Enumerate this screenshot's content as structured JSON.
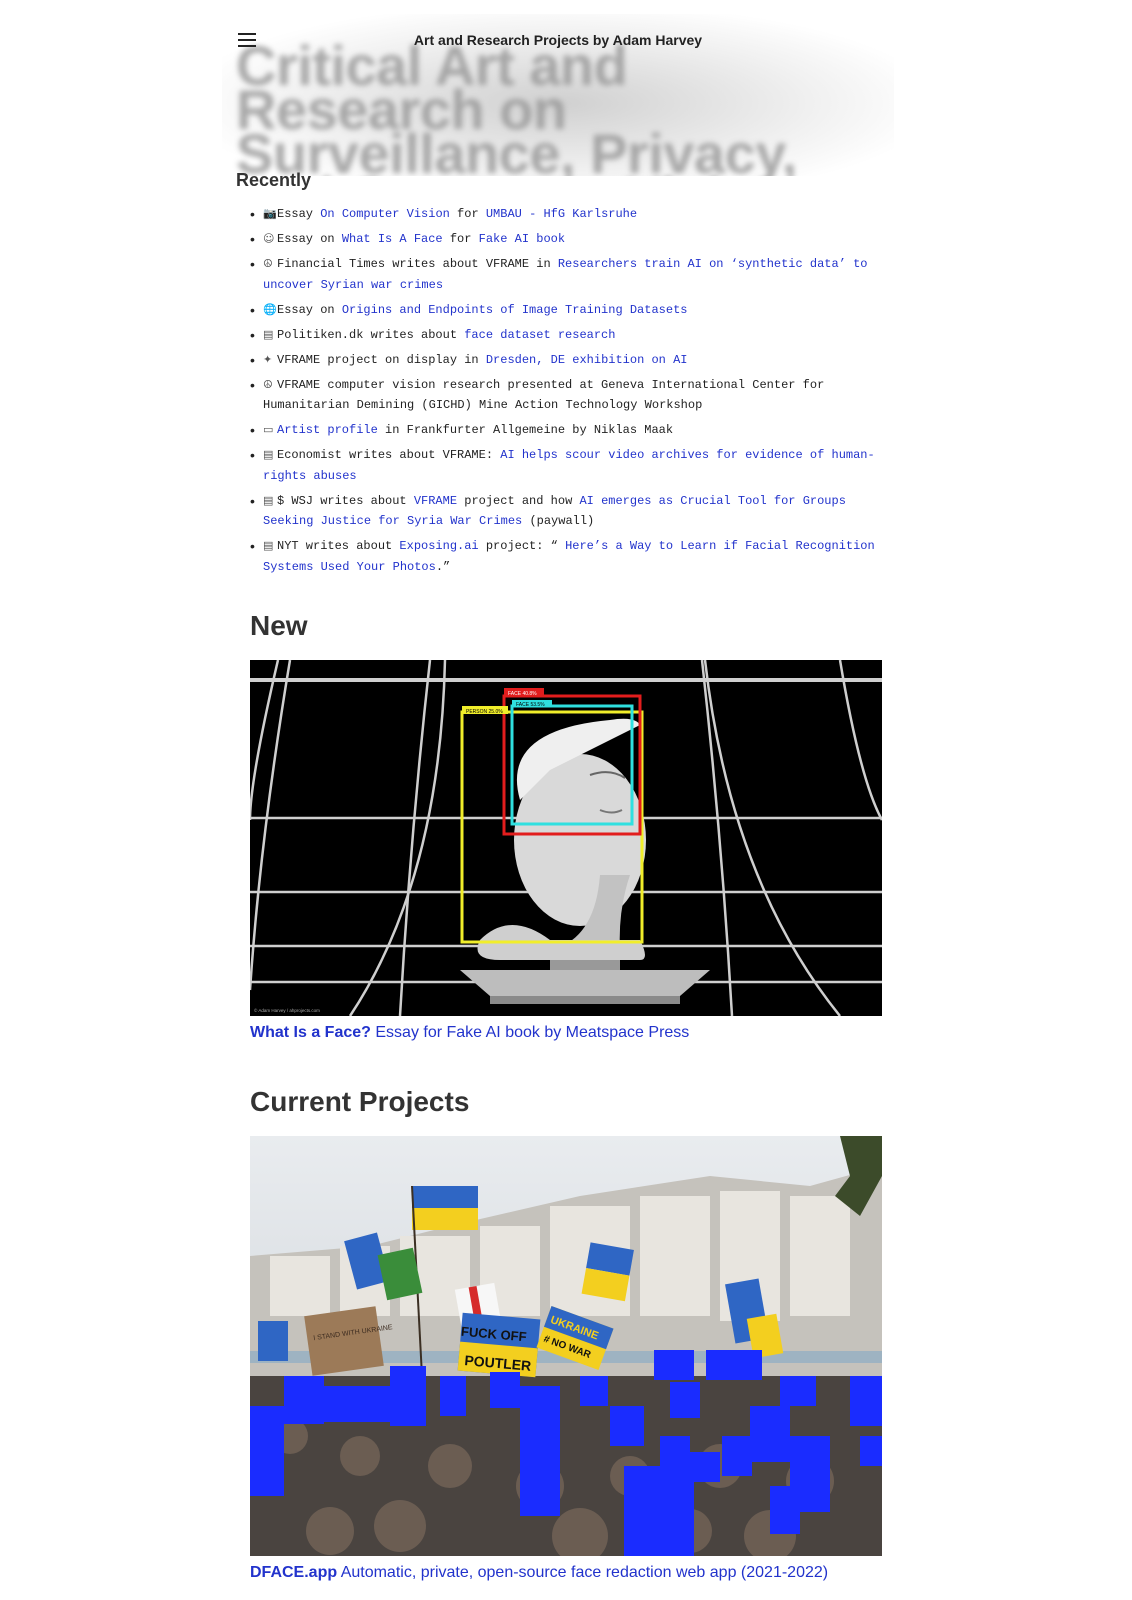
{
  "header": {
    "site_title": "Art and Research Projects by Adam Harvey",
    "hero_title": "Critical Art and Research on Surveillance, Privacy, and Computer Vision"
  },
  "recently": {
    "heading": "Recently",
    "items": [
      {
        "icon": "camera-icon",
        "parts": [
          {
            "t": "Essay ",
            "link": false
          },
          {
            "t": "On Computer Vision",
            "link": true
          },
          {
            "t": " for ",
            "link": false
          },
          {
            "t": "UMBAU - HfG Karlsruhe",
            "link": true
          }
        ]
      },
      {
        "icon": "face-icon",
        "parts": [
          {
            "t": "Essay on ",
            "link": false
          },
          {
            "t": "What Is A Face",
            "link": true
          },
          {
            "t": " for ",
            "link": false
          },
          {
            "t": "Fake AI book",
            "link": true
          }
        ]
      },
      {
        "icon": "peace-icon",
        "parts": [
          {
            "t": "Financial Times writes about VFRAME in ",
            "link": false
          },
          {
            "t": "Researchers train AI on ‘synthetic data’ to uncover Syrian war crimes",
            "link": true
          }
        ]
      },
      {
        "icon": "globe-icon",
        "parts": [
          {
            "t": "Essay on ",
            "link": false
          },
          {
            "t": "Origins and Endpoints of Image Training Datasets",
            "link": true
          }
        ]
      },
      {
        "icon": "newspaper-icon",
        "parts": [
          {
            "t": "Politiken.dk writes about ",
            "link": false
          },
          {
            "t": "face dataset research",
            "link": true
          }
        ]
      },
      {
        "icon": "artwork-icon",
        "parts": [
          {
            "t": "VFRAME project on display in ",
            "link": false
          },
          {
            "t": "Dresden, DE exhibition on AI",
            "link": true
          }
        ]
      },
      {
        "icon": "peace-icon",
        "parts": [
          {
            "t": "VFRAME computer vision research presented at Geneva International Center for Humanitarian Demining (GICHD) Mine Action Technology Workshop",
            "link": false
          }
        ]
      },
      {
        "icon": "id-card-icon",
        "parts": [
          {
            "t": "Artist profile",
            "link": true
          },
          {
            "t": " in Frankfurter Allgemeine by Niklas Maak",
            "link": false
          }
        ]
      },
      {
        "icon": "newspaper-icon",
        "parts": [
          {
            "t": "Economist writes about VFRAME: ",
            "link": false
          },
          {
            "t": "AI helps scour video archives for evidence of human-rights abuses",
            "link": true
          }
        ]
      },
      {
        "icon": "newspaper-icon",
        "parts": [
          {
            "t": "$ WSJ writes about ",
            "link": false
          },
          {
            "t": "VFRAME",
            "link": true
          },
          {
            "t": " project and how ",
            "link": false
          },
          {
            "t": "AI emerges as Crucial Tool for Groups Seeking Justice for Syria War Crimes",
            "link": true
          },
          {
            "t": " (paywall)",
            "link": false
          }
        ]
      },
      {
        "icon": "newspaper-icon",
        "parts": [
          {
            "t": "NYT writes about ",
            "link": false
          },
          {
            "t": "Exposing.ai",
            "link": true
          },
          {
            "t": " project: “ ",
            "link": false
          },
          {
            "t": "Here’s a Way to Learn if Facial Recognition Systems Used Your Photos",
            "link": true
          },
          {
            "t": ".”",
            "link": false
          }
        ]
      }
    ]
  },
  "new_section": {
    "heading": "New",
    "figure": {
      "labels": {
        "face1": "FACE 40.8%",
        "face2": "FACE 53.5%",
        "person": "PERSON 25.0%"
      },
      "credit": "© Adam Harvey / ahprojects.com"
    },
    "caption_bold": "What Is a Face?",
    "caption_rest": " Essay for Fake AI book by Meatspace Press"
  },
  "projects_section": {
    "heading": "Current Projects",
    "signs": {
      "sign1": "FUCK OFF",
      "sign2": "POUTLER",
      "sign3": "UKRAINE",
      "sign4": "# NO WAR",
      "sign5": "I STAND WITH UKRAINE"
    },
    "caption_bold": "DFACE.app",
    "caption_rest": " Automatic, private, open-source face redaction web app (2021-2022)"
  },
  "colors": {
    "link": "#2233cc",
    "redaction": "#1a2cff"
  }
}
